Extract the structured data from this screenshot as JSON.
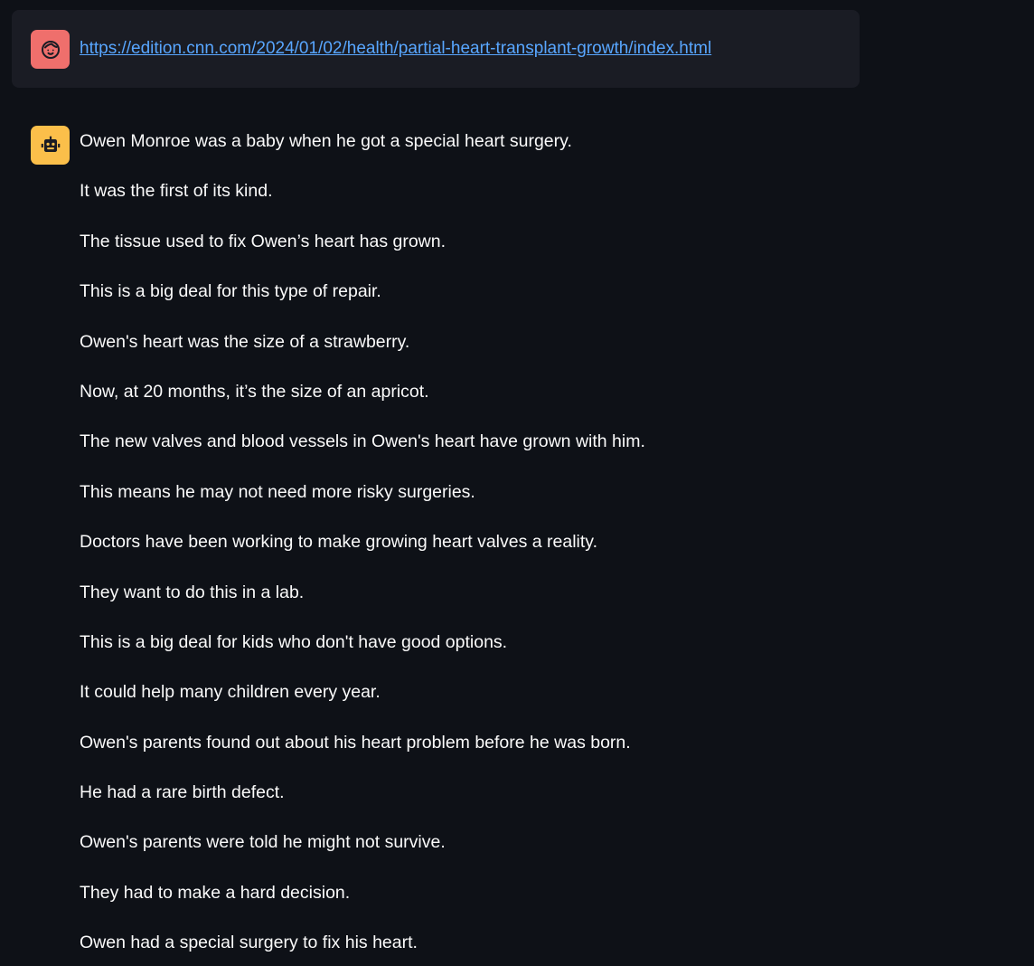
{
  "chat": {
    "user_message": {
      "avatar_icon": "face-icon",
      "avatar_color": "#ef6f6c",
      "link_text": "https://edition.cnn.com/2024/01/02/health/partial-heart-transplant-growth/index.html"
    },
    "assistant_message": {
      "avatar_icon": "robot-icon",
      "avatar_color": "#fbbf4a",
      "lines": [
        "Owen Monroe was a baby when he got a special heart surgery.",
        "It was the first of its kind.",
        "The tissue used to fix Owen’s heart has grown.",
        "This is a big deal for this type of repair.",
        "Owen's heart was the size of a strawberry.",
        "Now, at 20 months, it’s the size of an apricot.",
        "The new valves and blood vessels in Owen's heart have grown with him.",
        "This means he may not need more risky surgeries.",
        "Doctors have been working to make growing heart valves a reality.",
        "They want to do this in a lab.",
        "This is a big deal for kids who don't have good options.",
        "It could help many children every year.",
        "Owen's parents found out about his heart problem before he was born.",
        "He had a rare birth defect.",
        "Owen's parents were told he might not survive.",
        "They had to make a hard decision.",
        "Owen had a special surgery to fix his heart."
      ]
    }
  }
}
